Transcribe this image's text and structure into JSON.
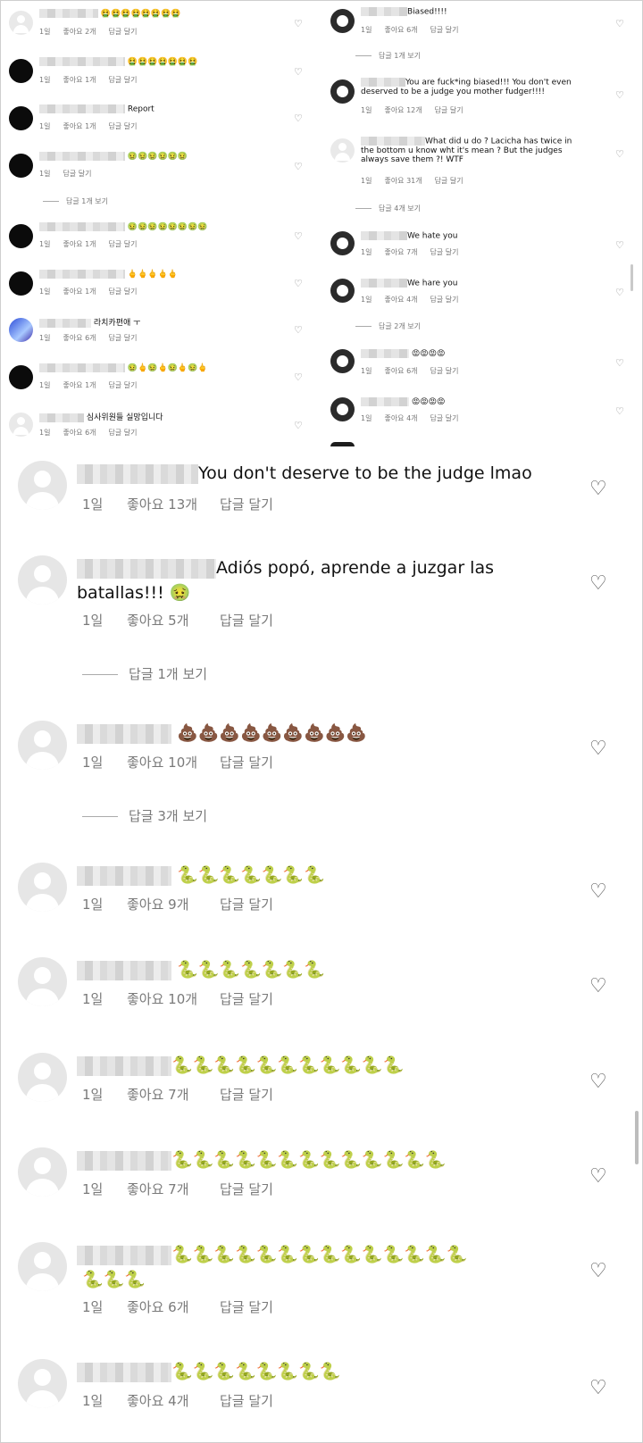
{
  "left_column": [
    {
      "text": "🤮🤮🤮🤮🤮🤮🤮🤮",
      "meta": [
        "1일",
        "좋아요 2개",
        "답글 달기"
      ]
    },
    {
      "text": "🤮🤮🤮🤮🤮🤮🤮",
      "meta": [
        "1일",
        "좋아요 1개",
        "답글 달기"
      ]
    },
    {
      "text": "Report",
      "meta": [
        "1일",
        "좋아요 1개",
        "답글 달기"
      ]
    },
    {
      "text": "🤢🤢🤢🤢🤢🤢",
      "meta": [
        "1일",
        "답글 달기"
      ],
      "replies": "답글 1개 보기"
    },
    {
      "text": "🤢🤢🤢🤢🤢🤢🤢🤢",
      "meta": [
        "1일",
        "좋아요 1개",
        "답글 달기"
      ]
    },
    {
      "text": "🖕🖕🖕🖕🖕",
      "meta": [
        "1일",
        "좋아요 1개",
        "답글 달기"
      ]
    },
    {
      "text": "라치카편애 ㅜ",
      "meta": [
        "1일",
        "좋아요 6개",
        "답글 달기"
      ]
    },
    {
      "text": "🤢🖕🤢🖕🤢🖕🤢🖕",
      "meta": [
        "1일",
        "좋아요 1개",
        "답글 달기"
      ]
    },
    {
      "text": "심사위원들 실망입니다",
      "meta": [
        "1일",
        "좋아요 6개",
        "답글 달기"
      ]
    }
  ],
  "right_column": [
    {
      "lines": [
        "Biased!!!!"
      ],
      "meta": [
        "1일",
        "좋아요 6개",
        "답글 달기"
      ],
      "replies": "답글 1개 보기"
    },
    {
      "lines": [
        "You are fuck*ing biased!!! You don't even",
        "deserved to be a judge you mother fudger!!!!"
      ],
      "meta": [
        "1일",
        "좋아요 12개",
        "답글 달기"
      ]
    },
    {
      "lines": [
        "What did u do ? Lacicha has twice in",
        "the bottom u know wht it's mean ? But the judges",
        "always save them ?! WTF"
      ],
      "meta": [
        "1일",
        "좋아요 31개",
        "답글 달기"
      ],
      "replies": "답글 4개 보기"
    },
    {
      "lines": [
        "We hate you"
      ],
      "meta": [
        "1일",
        "좋아요 7개",
        "답글 달기"
      ]
    },
    {
      "lines": [
        "We hare you"
      ],
      "meta": [
        "1일",
        "좋아요 4개",
        "답글 달기"
      ],
      "replies": "답글 2개 보기"
    },
    {
      "lines": [
        "😡😡😡😡"
      ],
      "meta": [
        "1일",
        "좋아요 6개",
        "답글 달기"
      ]
    },
    {
      "lines": [
        "😡😡😡😡"
      ],
      "meta": [
        "1일",
        "좋아요 4개",
        "답글 달기"
      ]
    }
  ],
  "big_comments": [
    {
      "lines": [
        "You don't deserve to be the judge lmao"
      ],
      "meta": [
        "1일",
        "좋아요 13개",
        "답글 달기"
      ]
    },
    {
      "lines": [
        "Adiós popó, aprende a juzgar las",
        "batallas!!! 🤢"
      ],
      "meta": [
        "1일",
        "좋아요 5개",
        "답글 달기"
      ],
      "replies": "답글 1개 보기"
    },
    {
      "lines": [
        "💩💩💩💩💩💩💩💩💩"
      ],
      "meta": [
        "1일",
        "좋아요 10개",
        "답글 달기"
      ],
      "replies": "답글 3개 보기"
    },
    {
      "lines": [
        "🐍🐍🐍🐍🐍🐍🐍"
      ],
      "meta": [
        "1일",
        "좋아요 9개",
        "답글 달기"
      ]
    },
    {
      "lines": [
        "🐍🐍🐍🐍🐍🐍🐍"
      ],
      "meta": [
        "1일",
        "좋아요 10개",
        "답글 달기"
      ]
    },
    {
      "lines": [
        "🐍🐍🐍🐍🐍🐍🐍🐍🐍🐍🐍"
      ],
      "meta": [
        "1일",
        "좋아요 7개",
        "답글 달기"
      ]
    },
    {
      "lines": [
        "🐍🐍🐍🐍🐍🐍🐍🐍🐍🐍🐍🐍🐍"
      ],
      "meta": [
        "1일",
        "좋아요 7개",
        "답글 달기"
      ]
    },
    {
      "lines": [
        "🐍🐍🐍🐍🐍🐍🐍🐍🐍🐍🐍🐍🐍🐍",
        "🐍🐍🐍"
      ],
      "meta": [
        "1일",
        "좋아요 6개",
        "답글 달기"
      ]
    },
    {
      "lines": [
        "🐍🐍🐍🐍🐍🐍🐍🐍"
      ],
      "meta": [
        "1일",
        "좋아요 4개",
        "답글 달기"
      ]
    }
  ],
  "icons": {
    "heart": "heart-icon",
    "avatar_default": "default-avatar-icon",
    "share": "share-icon"
  }
}
